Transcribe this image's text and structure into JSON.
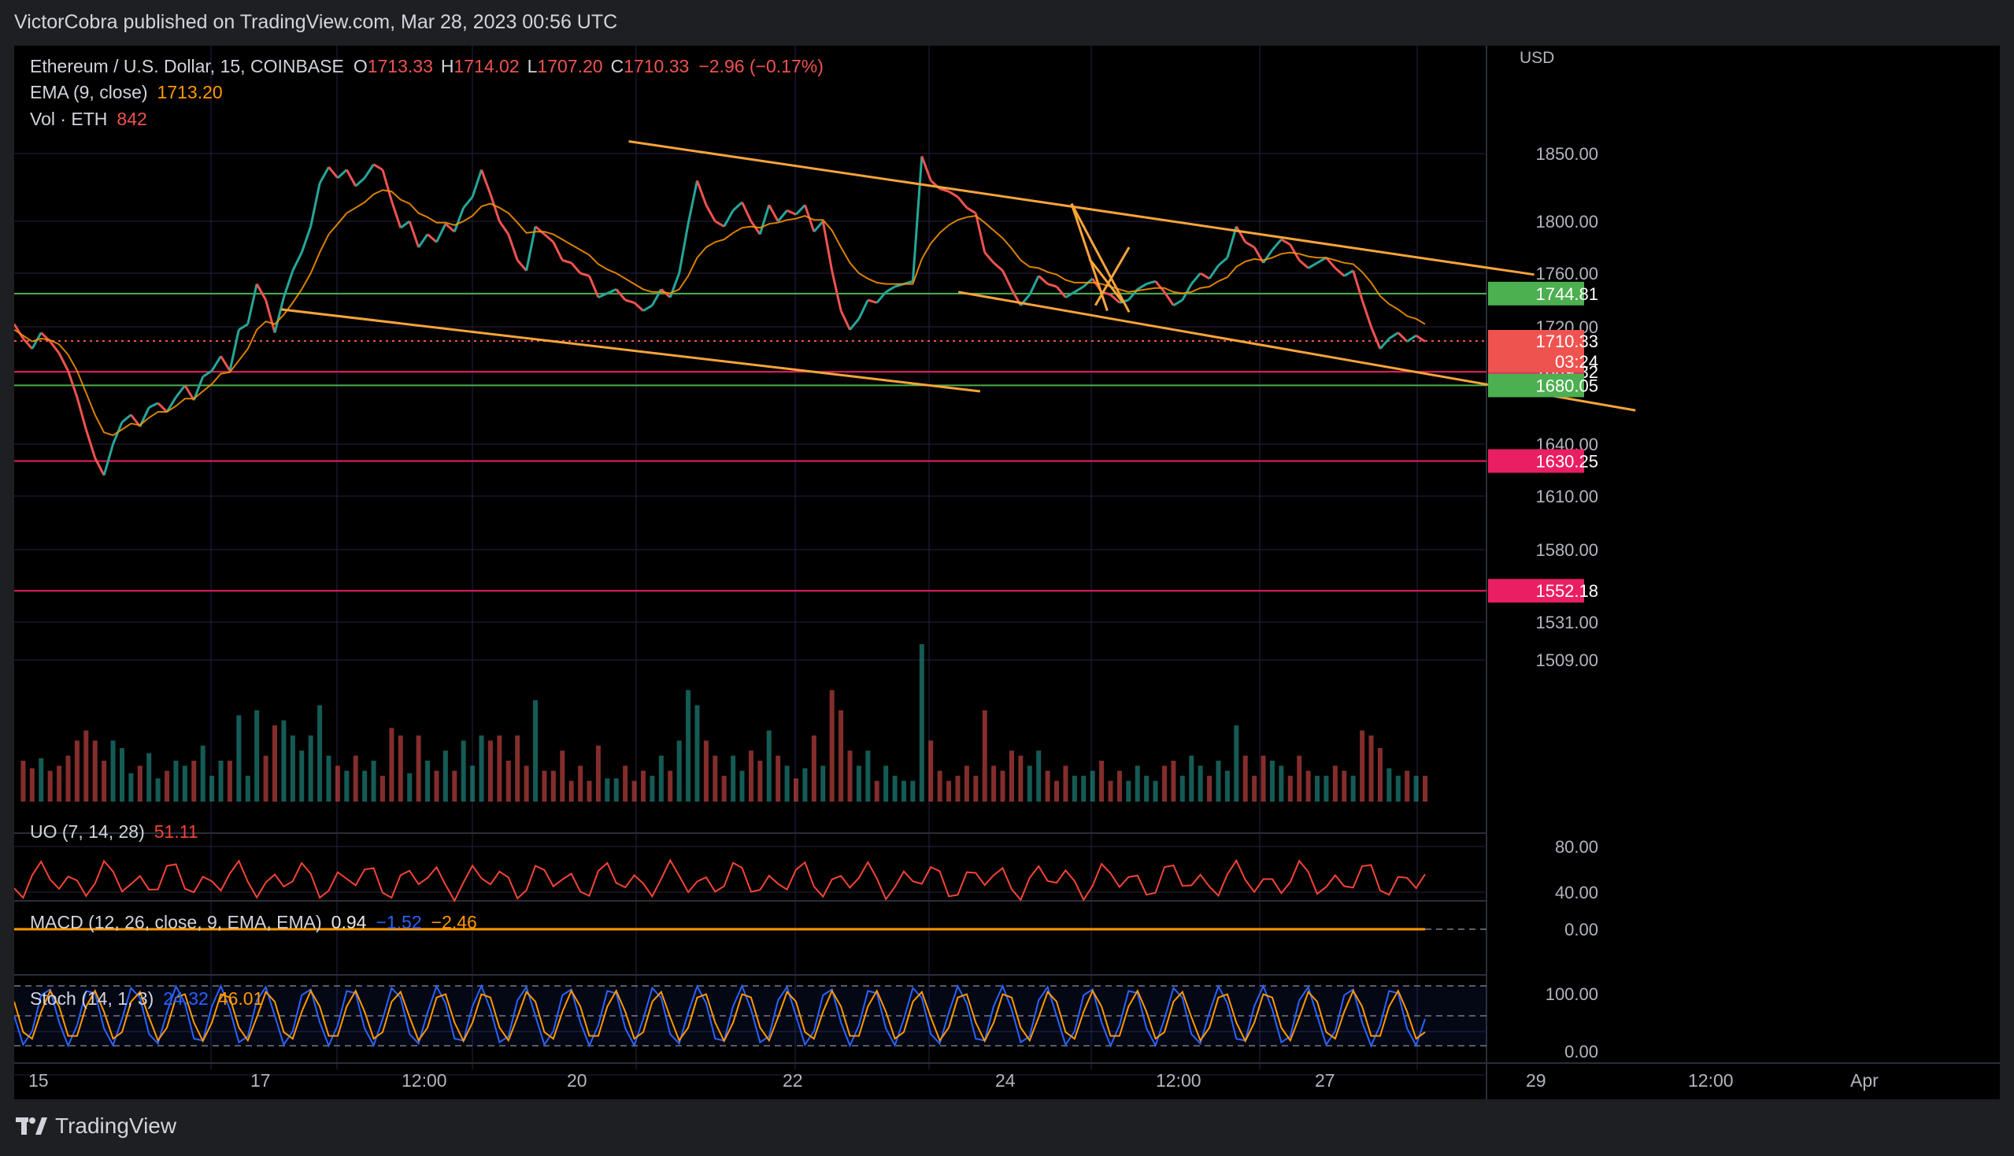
{
  "header": {
    "published": "VictorCobra published on TradingView.com, Mar 28, 2023 00:56 UTC"
  },
  "footer": {
    "brand": "TradingView"
  },
  "legend": {
    "symbol": "Ethereum / U.S. Dollar, 15, COINBASE",
    "o_label": "O",
    "o_value": "1713.33",
    "h_label": "H",
    "h_value": "1714.02",
    "l_label": "L",
    "l_value": "1707.20",
    "c_label": "C",
    "c_value": "1710.33",
    "change": "−2.96 (−0.17%)",
    "ema_label": "EMA (9, close)",
    "ema_value": "1713.20",
    "vol_label": "Vol · ETH",
    "vol_value": "842",
    "uo_label": "UO (7, 14, 28)",
    "uo_value": "51.11",
    "macd_label": "MACD (12, 26, close, 9, EMA, EMA)",
    "macd_v1": "0.94",
    "macd_v2": "−1.52",
    "macd_v3": "−2.46",
    "stoch_label": "Stoch (14, 1, 3)",
    "stoch_v1": "24.32",
    "stoch_v2": "46.01"
  },
  "colors": {
    "up": "#26a69a",
    "down": "#ef5350",
    "ema": "#ff9800",
    "trend": "#f7a43a",
    "support_green": "#4caf50",
    "support_pink": "#e91e63",
    "grid": "#2a1f45",
    "uo": "#f44336",
    "macd": "#2962ff",
    "signal": "#ff9800",
    "stoch_k": "#2962ff",
    "stoch_d": "#ff9800"
  },
  "chart_data": {
    "type": "line",
    "title": "Ethereum / U.S. Dollar, 15, COINBASE",
    "currency_label": "USD",
    "x_ticks": [
      "15",
      "17",
      "12:00",
      "20",
      "22",
      "24",
      "12:00",
      "27",
      "29",
      "12:00",
      "Apr"
    ],
    "price_ticks": [
      "1850.00",
      "1800.00",
      "1760.00",
      "1720.00",
      "1640.00",
      "1610.00",
      "1580.00",
      "1531.00",
      "1509.00"
    ],
    "ylim": [
      1495,
      1880
    ],
    "price_series": {
      "name": "ETHUSD",
      "values": [
        1722,
        1712,
        1705,
        1716,
        1710,
        1702,
        1690,
        1672,
        1650,
        1632,
        1622,
        1640,
        1655,
        1660,
        1652,
        1665,
        1668,
        1662,
        1672,
        1680,
        1670,
        1686,
        1690,
        1700,
        1690,
        1718,
        1722,
        1752,
        1740,
        1716,
        1742,
        1762,
        1776,
        1796,
        1828,
        1840,
        1832,
        1838,
        1826,
        1832,
        1842,
        1838,
        1815,
        1795,
        1800,
        1780,
        1790,
        1784,
        1798,
        1792,
        1810,
        1818,
        1838,
        1820,
        1800,
        1790,
        1770,
        1762,
        1796,
        1790,
        1784,
        1770,
        1768,
        1760,
        1758,
        1742,
        1745,
        1748,
        1740,
        1738,
        1732,
        1736,
        1748,
        1742,
        1760,
        1798,
        1830,
        1812,
        1800,
        1796,
        1808,
        1814,
        1800,
        1790,
        1812,
        1800,
        1808,
        1805,
        1812,
        1792,
        1800,
        1762,
        1732,
        1718,
        1726,
        1740,
        1738,
        1746,
        1750,
        1752,
        1754,
        1848,
        1830,
        1824,
        1822,
        1818,
        1810,
        1806,
        1776,
        1768,
        1762,
        1748,
        1736,
        1744,
        1758,
        1752,
        1750,
        1742,
        1746,
        1750,
        1756,
        1746,
        1744,
        1738,
        1740,
        1748,
        1752,
        1754,
        1746,
        1736,
        1740,
        1752,
        1760,
        1756,
        1766,
        1772,
        1796,
        1784,
        1780,
        1768,
        1778,
        1786,
        1782,
        1770,
        1764,
        1768,
        1772,
        1764,
        1758,
        1762,
        1740,
        1720,
        1705,
        1712,
        1716,
        1710,
        1714,
        1710
      ],
      "ema_values": [
        1718,
        1714,
        1710,
        1712,
        1711,
        1708,
        1701,
        1690,
        1675,
        1660,
        1648,
        1646,
        1650,
        1654,
        1653,
        1658,
        1662,
        1662,
        1666,
        1671,
        1671,
        1676,
        1681,
        1688,
        1689,
        1697,
        1705,
        1718,
        1724,
        1722,
        1729,
        1738,
        1748,
        1760,
        1776,
        1790,
        1798,
        1806,
        1810,
        1814,
        1820,
        1823,
        1822,
        1816,
        1813,
        1806,
        1803,
        1799,
        1799,
        1797,
        1800,
        1804,
        1811,
        1813,
        1810,
        1806,
        1799,
        1791,
        1792,
        1792,
        1790,
        1786,
        1782,
        1778,
        1774,
        1767,
        1763,
        1760,
        1756,
        1752,
        1748,
        1746,
        1746,
        1745,
        1748,
        1758,
        1772,
        1780,
        1784,
        1786,
        1791,
        1795,
        1796,
        1795,
        1798,
        1799,
        1801,
        1802,
        1804,
        1801,
        1801,
        1793,
        1780,
        1768,
        1760,
        1756,
        1753,
        1752,
        1752,
        1752,
        1752,
        1771,
        1783,
        1791,
        1797,
        1801,
        1803,
        1804,
        1799,
        1793,
        1787,
        1779,
        1770,
        1765,
        1764,
        1761,
        1759,
        1755,
        1753,
        1753,
        1753,
        1752,
        1750,
        1748,
        1746,
        1747,
        1748,
        1749,
        1749,
        1746,
        1745,
        1746,
        1749,
        1750,
        1754,
        1757,
        1765,
        1769,
        1771,
        1770,
        1772,
        1775,
        1776,
        1775,
        1773,
        1772,
        1772,
        1770,
        1768,
        1767,
        1761,
        1753,
        1743,
        1737,
        1733,
        1728,
        1726,
        1722
      ]
    },
    "horizontal_levels": [
      {
        "price": 1744.81,
        "label": "1744.81",
        "color": "green"
      },
      {
        "price": 1689.32,
        "label": "1689.32",
        "color": "pink"
      },
      {
        "price": 1680.05,
        "label": "1680.05",
        "color": "green"
      },
      {
        "price": 1630.25,
        "label": "1630.25",
        "color": "pink"
      },
      {
        "price": 1552.18,
        "label": "1552.18",
        "color": "pink"
      }
    ],
    "last_price": {
      "label": "1710.33",
      "countdown": "03:24",
      "price": 1710.33
    },
    "trendlines": [
      {
        "from": [
          0.1345,
          1733
        ],
        "to": [
          0.4865,
          1676
        ]
      },
      {
        "from": [
          0.3095,
          1859
        ],
        "to": [
          0.7655,
          1759
        ]
      },
      {
        "from": [
          0.4755,
          1746
        ],
        "to": [
          0.8165,
          1663
        ]
      },
      {
        "from": [
          0.5325,
          1813
        ],
        "to": [
          0.5615,
          1731
        ]
      },
      {
        "from": [
          0.5325,
          1813
        ],
        "to": [
          0.5505,
          1732
        ]
      },
      {
        "from": [
          0.5415,
          1771
        ],
        "to": [
          0.5585,
          1738
        ]
      },
      {
        "from": [
          0.5445,
          1736
        ],
        "to": [
          0.5615,
          1780
        ]
      }
    ],
    "volume_axis_ticks": [
      "1531.00",
      "1509.00"
    ],
    "uo": {
      "ticks": [
        "80.00",
        "40.00"
      ],
      "ylim": [
        30,
        90
      ],
      "last": 51.11
    },
    "macd": {
      "ticks": [
        "0.00"
      ],
      "values": [
        0.94,
        -1.52,
        -2.46
      ]
    },
    "stoch": {
      "ticks": [
        "100.00",
        "0.00"
      ],
      "ylim": [
        0,
        100
      ],
      "bands": [
        80,
        50,
        20
      ],
      "k_last": 24.32,
      "d_last": 46.01
    }
  }
}
